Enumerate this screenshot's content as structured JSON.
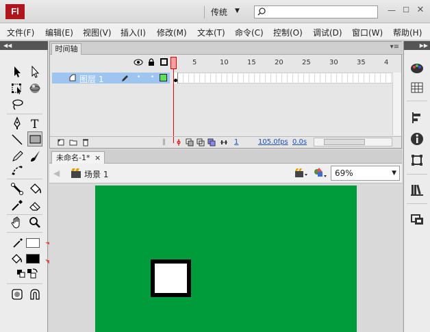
{
  "app": {
    "logo": "Fl",
    "workspace": "传统",
    "search_placeholder": ""
  },
  "menu": [
    "文件(F)",
    "编辑(E)",
    "视图(V)",
    "插入(I)",
    "修改(M)",
    "文本(T)",
    "命令(C)",
    "控制(O)",
    "调试(D)",
    "窗口(W)",
    "帮助(H)"
  ],
  "timeline": {
    "tab_label": "时间轴",
    "frame_numbers": [
      "1",
      "5",
      "10",
      "15",
      "20",
      "25",
      "30",
      "35",
      "4"
    ],
    "layer_name": "图层 1",
    "current_frame": "1",
    "frame_rate": "105.0fps",
    "elapsed": "0.0s"
  },
  "document": {
    "tab_label": "未命名-1*",
    "tab_close": "×",
    "scene_label": "场景 1",
    "zoom": "69%"
  },
  "colors": {
    "stage": "#009b3a",
    "stroke_color": "#ffffff",
    "fill_color": "#000000",
    "layer_highlight": "#9ec5ef",
    "playhead": "#ee0000",
    "annotation_arrow": "#e8483c"
  },
  "tools": [
    "selection-tool-icon",
    "subselection-tool-icon",
    "free-transform-tool-icon",
    "3d-rotation-tool-icon",
    "lasso-tool-icon",
    "pen-tool-icon",
    "text-tool-icon",
    "line-tool-icon",
    "rectangle-tool-icon",
    "pencil-tool-icon",
    "brush-tool-icon",
    "deco-tool-icon",
    "bone-tool-icon",
    "paint-bucket-tool-icon",
    "eyedropper-tool-icon",
    "eraser-tool-icon",
    "hand-tool-icon",
    "zoom-tool-icon",
    "stroke-color-icon",
    "fill-color-icon",
    "black-white-icon",
    "swap-colors-icon",
    "object-drawing-icon",
    "snap-magnet-icon"
  ],
  "right_panel_icons": [
    "color-panel-icon",
    "swatches-panel-icon",
    "align-panel-icon",
    "info-panel-icon",
    "transform-panel-icon",
    "library-panel-icon",
    "components-panel-icon"
  ]
}
